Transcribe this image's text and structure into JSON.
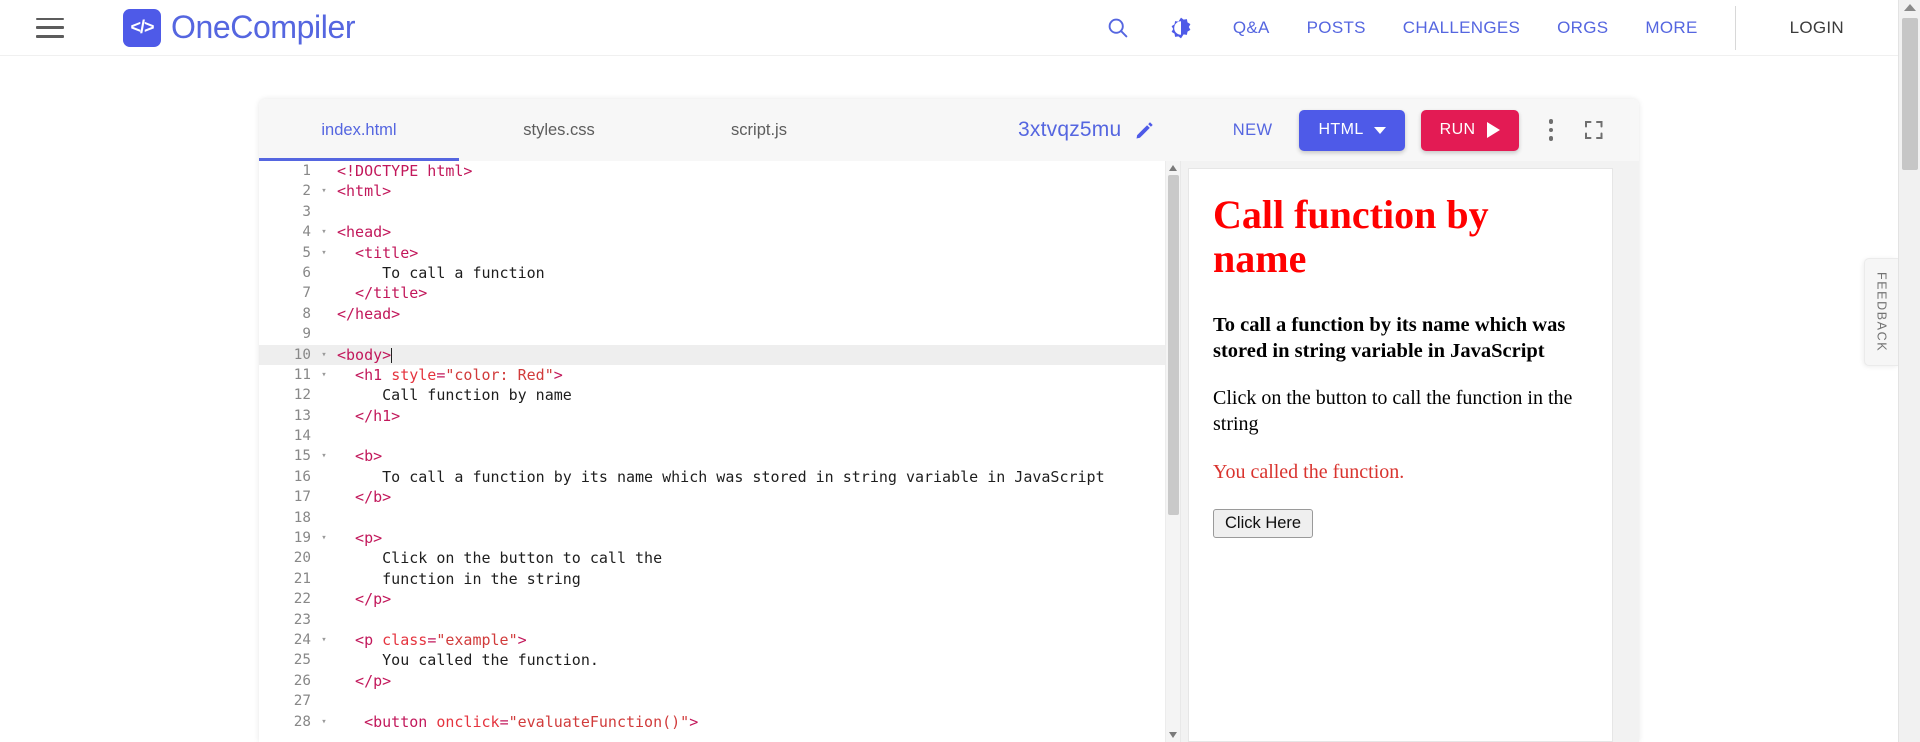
{
  "nav": {
    "menu_icon": "hamburger-menu-icon",
    "brand": {
      "logo_glyph": "</>",
      "name": "OneCompiler"
    },
    "search_icon": "search-icon",
    "theme_icon": "dark-mode-toggle-icon",
    "links": [
      "Q&A",
      "POSTS",
      "CHALLENGES",
      "ORGS",
      "MORE"
    ],
    "login": "LOGIN"
  },
  "feedback": {
    "label": "FEEDBACK"
  },
  "ide": {
    "tabs": [
      {
        "label": "index.html",
        "active": true
      },
      {
        "label": "styles.css",
        "active": false
      },
      {
        "label": "script.js",
        "active": false
      }
    ],
    "project_name": "3xtvqz5mu",
    "edit_icon": "pencil-edit-icon",
    "new_label": "NEW",
    "language_label": "HTML",
    "language_caret": "chevron-down-icon",
    "run_label": "RUN",
    "run_icon": "play-icon",
    "more_icon": "kebab-menu-icon",
    "fullscreen_icon": "fullscreen-expand-icon"
  },
  "editor": {
    "active_line": 10,
    "lines": [
      {
        "n": 1,
        "fold": "",
        "tokens": [
          {
            "t": "tag",
            "v": "<!DOCTYPE html>"
          }
        ]
      },
      {
        "n": 2,
        "fold": "▾",
        "tokens": [
          {
            "t": "tag",
            "v": "<html>"
          }
        ]
      },
      {
        "n": 3,
        "fold": "",
        "tokens": []
      },
      {
        "n": 4,
        "fold": "▾",
        "tokens": [
          {
            "t": "tag",
            "v": "<head>"
          }
        ]
      },
      {
        "n": 5,
        "fold": "▾",
        "tokens": [
          {
            "t": "tag",
            "v": "  <title>"
          }
        ]
      },
      {
        "n": 6,
        "fold": "",
        "tokens": [
          {
            "t": "txt",
            "v": "     To call a function"
          }
        ]
      },
      {
        "n": 7,
        "fold": "",
        "tokens": [
          {
            "t": "tag",
            "v": "  </title>"
          }
        ]
      },
      {
        "n": 8,
        "fold": "",
        "tokens": [
          {
            "t": "tag",
            "v": "</head>"
          }
        ]
      },
      {
        "n": 9,
        "fold": "",
        "tokens": []
      },
      {
        "n": 10,
        "fold": "▾",
        "tokens": [
          {
            "t": "tag",
            "v": "<body>"
          },
          {
            "t": "caret",
            "v": ""
          }
        ]
      },
      {
        "n": 11,
        "fold": "▾",
        "tokens": [
          {
            "t": "tag",
            "v": "  <h1 "
          },
          {
            "t": "attr",
            "v": "style"
          },
          {
            "t": "tag",
            "v": "="
          },
          {
            "t": "str",
            "v": "\"color: Red\""
          },
          {
            "t": "tag",
            "v": ">"
          }
        ]
      },
      {
        "n": 12,
        "fold": "",
        "tokens": [
          {
            "t": "txt",
            "v": "     Call function by name"
          }
        ]
      },
      {
        "n": 13,
        "fold": "",
        "tokens": [
          {
            "t": "tag",
            "v": "  </h1>"
          }
        ]
      },
      {
        "n": 14,
        "fold": "",
        "tokens": []
      },
      {
        "n": 15,
        "fold": "▾",
        "tokens": [
          {
            "t": "tag",
            "v": "  <b>"
          }
        ]
      },
      {
        "n": 16,
        "fold": "",
        "tokens": [
          {
            "t": "txt",
            "v": "     To call a function by its name which was stored in string variable in JavaScript"
          }
        ]
      },
      {
        "n": 17,
        "fold": "",
        "tokens": [
          {
            "t": "tag",
            "v": "  </b>"
          }
        ]
      },
      {
        "n": 18,
        "fold": "",
        "tokens": []
      },
      {
        "n": 19,
        "fold": "▾",
        "tokens": [
          {
            "t": "tag",
            "v": "  <p>"
          }
        ]
      },
      {
        "n": 20,
        "fold": "",
        "tokens": [
          {
            "t": "txt",
            "v": "     Click on the button to call the"
          }
        ]
      },
      {
        "n": 21,
        "fold": "",
        "tokens": [
          {
            "t": "txt",
            "v": "     function in the string"
          }
        ]
      },
      {
        "n": 22,
        "fold": "",
        "tokens": [
          {
            "t": "tag",
            "v": "  </p>"
          }
        ]
      },
      {
        "n": 23,
        "fold": "",
        "tokens": []
      },
      {
        "n": 24,
        "fold": "▾",
        "tokens": [
          {
            "t": "tag",
            "v": "  <p "
          },
          {
            "t": "attr",
            "v": "class"
          },
          {
            "t": "tag",
            "v": "="
          },
          {
            "t": "str",
            "v": "\"example\""
          },
          {
            "t": "tag",
            "v": ">"
          }
        ]
      },
      {
        "n": 25,
        "fold": "",
        "tokens": [
          {
            "t": "txt",
            "v": "     You called the function."
          }
        ]
      },
      {
        "n": 26,
        "fold": "",
        "tokens": [
          {
            "t": "tag",
            "v": "  </p>"
          }
        ]
      },
      {
        "n": 27,
        "fold": "",
        "tokens": []
      },
      {
        "n": 28,
        "fold": "▾",
        "tokens": [
          {
            "t": "tag",
            "v": "   <button "
          },
          {
            "t": "attr",
            "v": "onclick"
          },
          {
            "t": "tag",
            "v": "="
          },
          {
            "t": "str",
            "v": "\"evaluateFunction()\""
          },
          {
            "t": "tag",
            "v": ">"
          }
        ]
      }
    ]
  },
  "preview": {
    "heading": "Call function by name",
    "heading_color": "#ff0000",
    "bold_text": "To call a function by its name which was stored in string variable in JavaScript",
    "paragraph": "Click on the button to call the function in the string",
    "example_text": "You called the function.",
    "example_color": "#d9332e",
    "button_label": "Click Here"
  }
}
